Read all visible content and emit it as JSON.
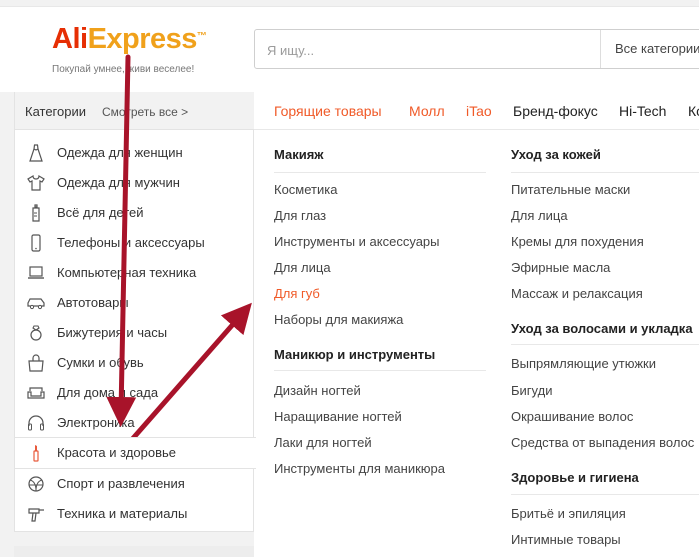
{
  "header": {
    "logo_ali": "Ali",
    "logo_express": "Express",
    "logo_tm": "™",
    "tagline": "Покупай умнее, живи веселее!",
    "search_placeholder": "Я ищу...",
    "search_category": "Все категории"
  },
  "sidebar": {
    "title": "Категории",
    "see_all": "Смотреть все >",
    "items": [
      {
        "label": "Одежда для женщин",
        "icon": "dress-icon"
      },
      {
        "label": "Одежда для мужчин",
        "icon": "tshirt-icon"
      },
      {
        "label": "Всё для детей",
        "icon": "baby-bottle-icon"
      },
      {
        "label": "Телефоны и аксессуары",
        "icon": "phone-icon"
      },
      {
        "label": "Компьютерная техника",
        "icon": "laptop-icon"
      },
      {
        "label": "Автотовары",
        "icon": "car-icon"
      },
      {
        "label": "Бижутерия и часы",
        "icon": "ring-icon"
      },
      {
        "label": "Сумки и обувь",
        "icon": "bag-icon"
      },
      {
        "label": "Для дома и сада",
        "icon": "sofa-icon"
      },
      {
        "label": "Электроника",
        "icon": "headphones-icon"
      },
      {
        "label": "Красота и здоровье",
        "icon": "lipstick-icon"
      },
      {
        "label": "Спорт и развлечения",
        "icon": "ball-icon"
      },
      {
        "label": "Техника и материалы",
        "icon": "drill-icon"
      }
    ]
  },
  "nav": [
    "Горящие товары",
    "Молл",
    "iTao",
    "Бренд-фокус",
    "Hi-Tech",
    "Ко"
  ],
  "col1": {
    "g1_title": "Макияж",
    "g1_links": [
      "Косметика",
      "Для глаз",
      "Инструменты и аксессуары",
      "Для лица",
      "Для губ",
      "Наборы для макияжа"
    ],
    "g2_title": "Маникюр и инструменты",
    "g2_links": [
      "Дизайн ногтей",
      "Наращивание ногтей",
      "Лаки для ногтей",
      "Инструменты для маникюра"
    ]
  },
  "col2": {
    "g1_title": "Уход за кожей",
    "g1_links": [
      "Питательные маски",
      "Для лица",
      "Кремы для похудения",
      "Эфирные масла",
      "Массаж и релаксация"
    ],
    "g2_title": "Уход за волосами и укладка",
    "g2_links": [
      "Выпрямляющие утюжки",
      "Бигуди",
      "Окрашивание волос",
      "Средства от выпадения волос"
    ],
    "g3_title": "Здоровье и гигиена",
    "g3_links": [
      "Бритьё и эпиляция",
      "Интимные товары"
    ]
  },
  "colors": {
    "brand_red": "#e62e04",
    "brand_orange": "#f0a11b",
    "link_orange": "#f05a28",
    "arrow": "#a8132a"
  }
}
